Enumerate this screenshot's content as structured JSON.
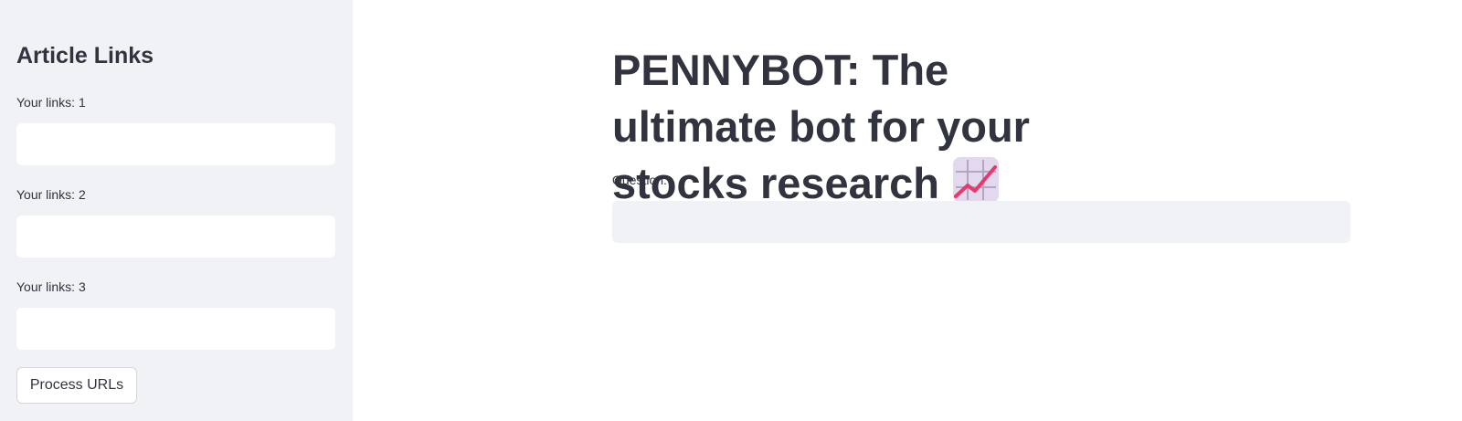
{
  "sidebar": {
    "title": "Article Links",
    "fields": [
      {
        "label": "Your links: 1",
        "value": ""
      },
      {
        "label": "Your links: 2",
        "value": ""
      },
      {
        "label": "Your links: 3",
        "value": ""
      }
    ],
    "process_button": "Process URLs"
  },
  "main": {
    "title": "PENNYBOT: The ultimate bot for your stocks research",
    "title_icon": "chart-increasing-icon",
    "question_label": "Question:",
    "question_value": ""
  },
  "colors": {
    "sidebar_bg": "#f0f2f6",
    "text": "#31333f",
    "question_input_bg": "#f0f2f6",
    "emoji_tile": "#e2d9ee",
    "emoji_line": "#e8396a"
  }
}
